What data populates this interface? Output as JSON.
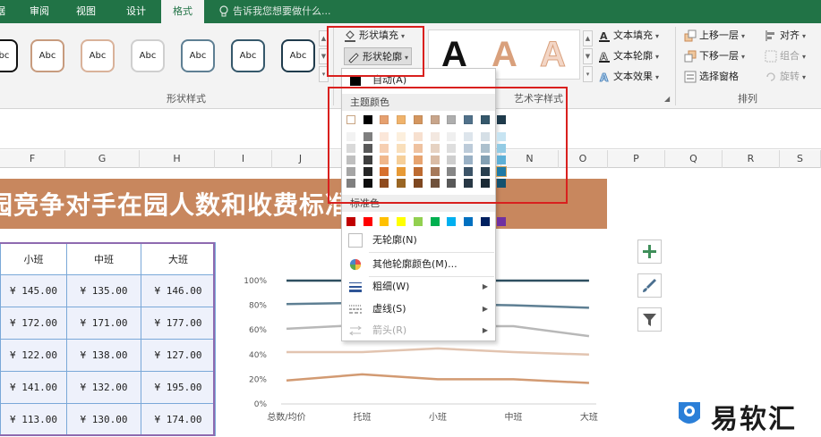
{
  "tabs": [
    {
      "label": "数据",
      "active": false
    },
    {
      "label": "审阅",
      "active": false
    },
    {
      "label": "视图",
      "active": false
    },
    {
      "label": "设计",
      "active": false
    },
    {
      "label": "格式",
      "active": true
    }
  ],
  "tell_me": "告诉我您想要做什么...",
  "shape_styles": {
    "thumbnail_label": "Abc",
    "group_label": "形状样式",
    "fill_button": "形状填充",
    "outline_button": "形状轮廓"
  },
  "wordart": {
    "letter": "A",
    "text_fill": "文本填充",
    "text_outline": "文本轮廓",
    "text_effect": "文本效果",
    "group_label": "艺术字样式"
  },
  "arrange": {
    "bring_forward": "上移一层",
    "send_backward": "下移一层",
    "selection_pane": "选择窗格",
    "align": "对齐",
    "group": "组合",
    "rotate": "旋转",
    "group_label": "排列"
  },
  "columns": [
    "F",
    "G",
    "H",
    "I",
    "J",
    "K",
    "L",
    "M",
    "N",
    "O",
    "P",
    "Q",
    "R",
    "S"
  ],
  "banner_title": "园竞争对手在园人数和收费标准",
  "table": {
    "headers": [
      "小班",
      "中班",
      "大班"
    ],
    "rows": [
      [
        "¥ 145.00",
        "¥ 135.00",
        "¥ 146.00"
      ],
      [
        "¥ 172.00",
        "¥ 171.00",
        "¥ 177.00"
      ],
      [
        "¥ 122.00",
        "¥ 138.00",
        "¥ 127.00"
      ],
      [
        "¥ 141.00",
        "¥ 132.00",
        "¥ 195.00"
      ],
      [
        "¥ 113.00",
        "¥ 130.00",
        "¥ 174.00"
      ]
    ]
  },
  "chart_data": {
    "type": "line",
    "categories": [
      "总数/均价",
      "托班",
      "小班",
      "中班",
      "大班"
    ],
    "ylim": [
      0,
      100
    ],
    "yticks": [
      "0%",
      "20%",
      "40%",
      "60%",
      "80%",
      "100%"
    ],
    "series": [
      {
        "color": "#2e4f60",
        "values": [
          100,
          100,
          100,
          100,
          100
        ]
      },
      {
        "color": "#5e7f93",
        "values": [
          81,
          82,
          81,
          80,
          78
        ]
      },
      {
        "color": "#b8b8b8",
        "values": [
          61,
          64,
          63,
          63,
          55
        ]
      },
      {
        "color": "#e2c4b0",
        "values": [
          42,
          42,
          45,
          42,
          40
        ]
      },
      {
        "color": "#d29a72",
        "values": [
          19,
          24,
          20,
          20,
          17
        ]
      }
    ],
    "grid": false
  },
  "outline_menu": {
    "auto_label": "自动(A)",
    "theme_colors_label": "主题颜色",
    "theme_top_row": [
      "#ffffff",
      "#000000",
      "#e6a06f",
      "#f0b36c",
      "#d4965f",
      "#c8a58b",
      "#aeaeae",
      "#51718a",
      "#35586b",
      "#1f3b4c"
    ],
    "theme_shades": [
      [
        "#f2f2f2",
        "#7f7f7f",
        "#fbe7d9",
        "#fcefdd",
        "#f7e0cf",
        "#f3e8e0",
        "#efefef",
        "#dde5ec",
        "#d5dfe6",
        "#c7e4f2"
      ],
      [
        "#d9d9d9",
        "#595959",
        "#f6cfb2",
        "#f9dfbb",
        "#efc2a0",
        "#e6d2c2",
        "#dedede",
        "#bccbd9",
        "#acc0cd",
        "#93cbe4"
      ],
      [
        "#bfbfbf",
        "#3f3f3f",
        "#f0b78b",
        "#f6cf99",
        "#e7a470",
        "#dabca5",
        "#cecece",
        "#9ab1c5",
        "#83a1b4",
        "#5eb0d7"
      ],
      [
        "#a5a5a5",
        "#262626",
        "#d7702d",
        "#e79a36",
        "#bd6b31",
        "#a6795a",
        "#868686",
        "#3c5468",
        "#283f4f",
        "#1f7aa5"
      ],
      [
        "#7f7f7f",
        "#0d0d0d",
        "#8f4b1e",
        "#9a6624",
        "#7e4720",
        "#6f513b",
        "#595959",
        "#283845",
        "#1a2a35",
        "#14516e"
      ]
    ],
    "standard_colors_label": "标准色",
    "standard_colors": [
      "#c00000",
      "#ff0000",
      "#ffc000",
      "#ffff00",
      "#92d050",
      "#00b050",
      "#00b0f0",
      "#0070c0",
      "#002060",
      "#7030a0"
    ],
    "no_outline": "无轮廓(N)",
    "more_colors": "其他轮廓颜色(M)...",
    "weight": "粗细(W)",
    "dashes": "虚线(S)",
    "arrows": "箭头(R)"
  },
  "watermark": "易软汇"
}
